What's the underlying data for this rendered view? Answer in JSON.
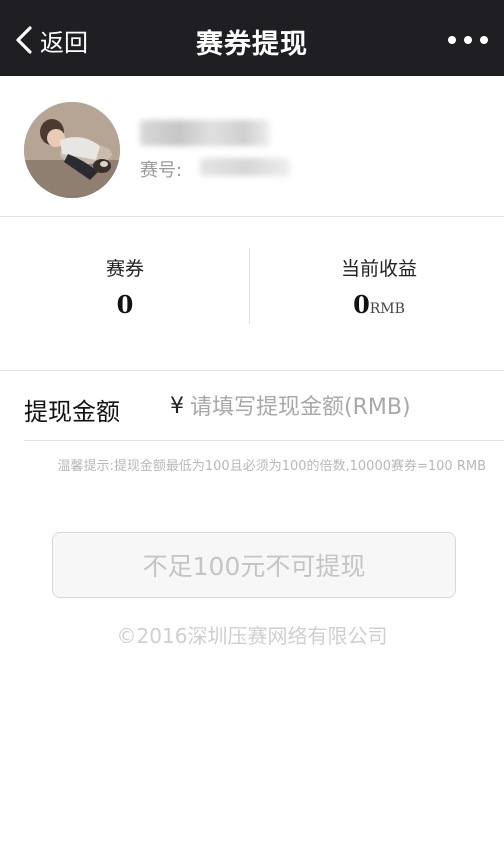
{
  "navbar": {
    "back_label": "返回",
    "title": "赛券提现",
    "background": "#1f1e23"
  },
  "profile": {
    "id_label": "赛号:"
  },
  "stats": {
    "coupon_label": "赛券",
    "coupon_value": "0",
    "earnings_label": "当前收益",
    "earnings_value": "0",
    "earnings_unit": "RMB"
  },
  "withdraw": {
    "label": "提现金额",
    "currency_symbol": "¥",
    "placeholder": "请填写提现金额(RMB)",
    "value": ""
  },
  "tip": "温馨提示:提现金额最低为100且必须为100的倍数,10000赛券=100 RMB",
  "submit": {
    "label": "不足100元不可提现"
  },
  "footer": {
    "copyright": "©2016深圳压赛网络有限公司"
  },
  "icons": {
    "back": "chevron-left-icon",
    "more": "more-dots-icon"
  }
}
